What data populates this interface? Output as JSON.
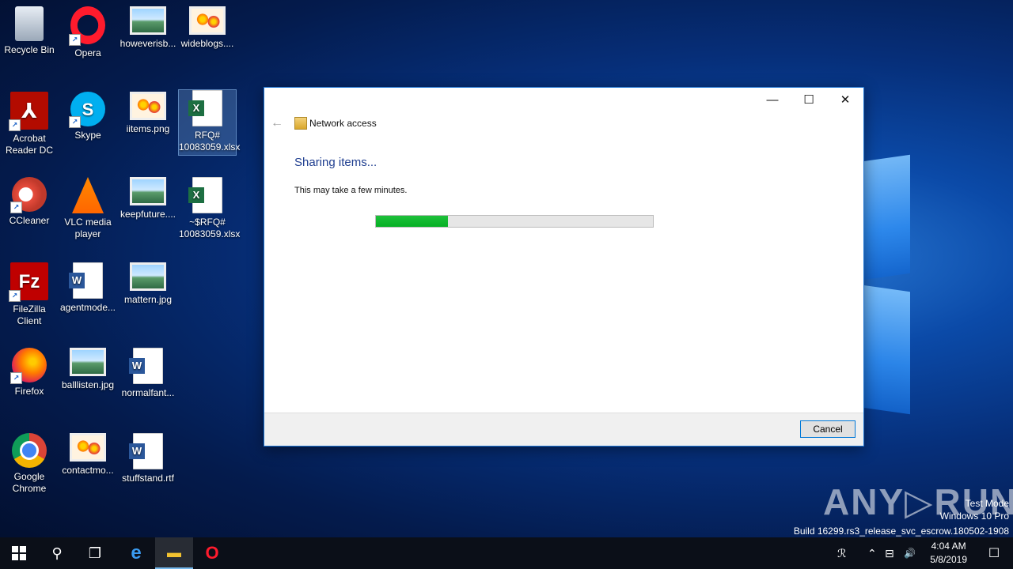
{
  "desktop": {
    "icons": [
      {
        "label": "Recycle Bin"
      },
      {
        "label": "Opera"
      },
      {
        "label": "howeverisb..."
      },
      {
        "label": "wideblogs...."
      },
      {
        "label": "Acrobat Reader DC"
      },
      {
        "label": "Skype"
      },
      {
        "label": "iitems.png"
      },
      {
        "label": "RFQ# 10083059.xlsx"
      },
      {
        "label": "CCleaner"
      },
      {
        "label": "VLC media player"
      },
      {
        "label": "keepfuture...."
      },
      {
        "label": "~$RFQ# 10083059.xlsx"
      },
      {
        "label": "FileZilla Client"
      },
      {
        "label": "agentmode..."
      },
      {
        "label": "mattern.jpg"
      },
      {
        "label": "Firefox"
      },
      {
        "label": "balllisten.jpg"
      },
      {
        "label": "normalfant..."
      },
      {
        "label": "Google Chrome"
      },
      {
        "label": "contactmo..."
      },
      {
        "label": "stuffstand.rtf"
      }
    ]
  },
  "dialog": {
    "nav_title": "Network access",
    "heading": "Sharing items...",
    "subtext": "This may take a few minutes.",
    "progress_percent": 26,
    "cancel_label": "Cancel",
    "minimize_glyph": "—",
    "maximize_glyph": "☐",
    "close_glyph": "✕",
    "back_glyph": "←"
  },
  "watermark": {
    "logo": "ANY▷RUN",
    "line1": "Test Mode",
    "line2": "Windows 10 Pro",
    "line3": "Build 16299.rs3_release_svc_escrow.180502-1908"
  },
  "taskbar": {
    "search_glyph": "⚲",
    "taskview_glyph": "❐",
    "edge_glyph": "e",
    "explorer_glyph": "▬",
    "opera_glyph": "O",
    "people_glyph": "ℛ",
    "chevron_glyph": "⌃",
    "network_glyph": "⊟",
    "volume_glyph": "🔊",
    "time": "4:04 AM",
    "date": "5/8/2019",
    "notification_glyph": "☐"
  }
}
